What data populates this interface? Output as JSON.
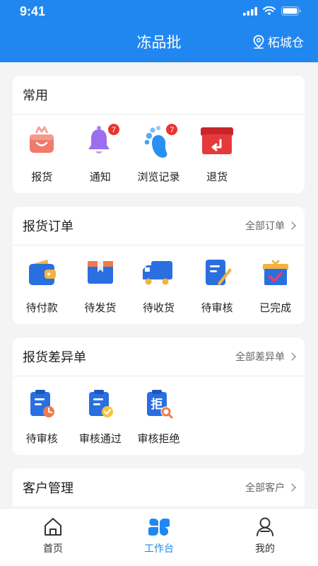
{
  "status_bar": {
    "time": "9:41"
  },
  "header": {
    "title": "冻品批",
    "location": "柘城仓"
  },
  "sections": {
    "common": {
      "title": "常用",
      "items": [
        {
          "label": "报货",
          "icon": "shopping-basket-icon"
        },
        {
          "label": "通知",
          "icon": "bell-icon",
          "badge": "7"
        },
        {
          "label": "浏览记录",
          "icon": "footprint-icon",
          "badge": "7"
        },
        {
          "label": "退货",
          "icon": "return-box-icon"
        }
      ]
    },
    "orders": {
      "title": "报货订单",
      "more": "全部订单",
      "items": [
        {
          "label": "待付款",
          "icon": "wallet-icon"
        },
        {
          "label": "待发货",
          "icon": "package-icon"
        },
        {
          "label": "待收货",
          "icon": "truck-icon"
        },
        {
          "label": "待审核",
          "icon": "edit-document-icon"
        },
        {
          "label": "已完成",
          "icon": "gift-box-check-icon"
        }
      ]
    },
    "discrepancy": {
      "title": "报货差异单",
      "more": "全部差异单",
      "items": [
        {
          "label": "待审核",
          "icon": "clipboard-clock-icon"
        },
        {
          "label": "审核通过",
          "icon": "clipboard-check-icon"
        },
        {
          "label": "审核拒绝",
          "icon": "clipboard-reject-icon",
          "glyph": "拒"
        }
      ]
    },
    "customers": {
      "title": "客户管理",
      "more": "全部客户"
    }
  },
  "tabbar": [
    {
      "label": "首页",
      "icon": "home-icon"
    },
    {
      "label": "工作台",
      "icon": "workbench-icon",
      "active": true
    },
    {
      "label": "我的",
      "icon": "profile-icon"
    }
  ],
  "colors": {
    "primary": "#2187f0",
    "badge": "#e8342e",
    "background": "#f4f4f4"
  }
}
